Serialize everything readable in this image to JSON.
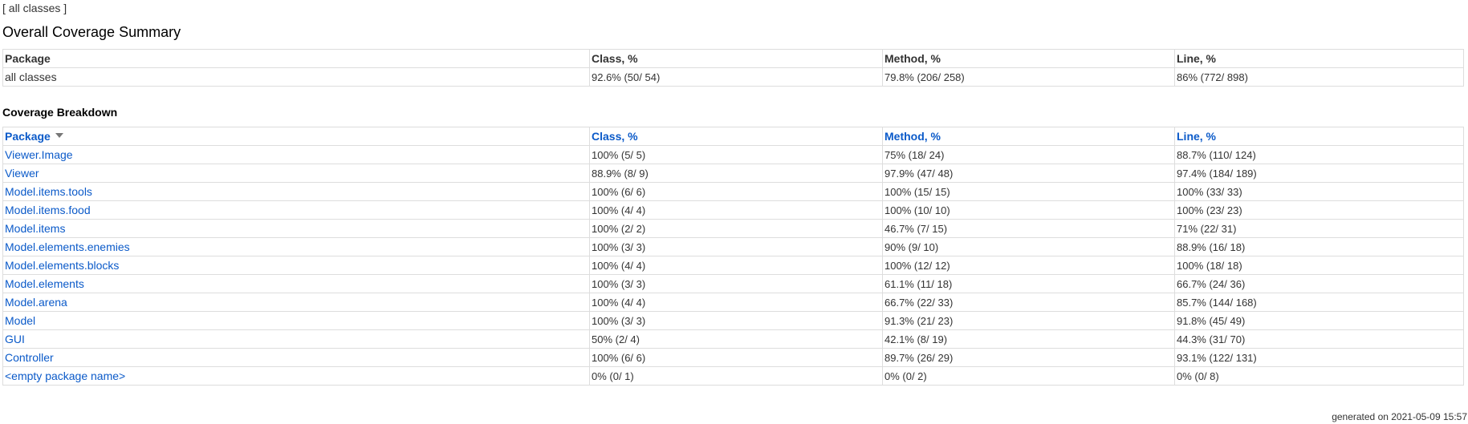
{
  "breadcrumb": "[ all classes ]",
  "page_title": "Overall Coverage Summary",
  "summary": {
    "headers": {
      "package": "Package",
      "class": "Class, %",
      "method": "Method, %",
      "line": "Line, %"
    },
    "row": {
      "name": "all classes",
      "class": "92.6% (50/ 54)",
      "method": "79.8% (206/ 258)",
      "line": "86% (772/ 898)"
    }
  },
  "breakdown": {
    "title": "Coverage Breakdown",
    "headers": {
      "package": "Package",
      "class": "Class, %",
      "method": "Method, %",
      "line": "Line, %"
    },
    "sort_icon": "sort-descending-icon",
    "rows": [
      {
        "name": "Viewer.Image",
        "class": "100% (5/ 5)",
        "method": "75% (18/ 24)",
        "line": "88.7% (110/ 124)"
      },
      {
        "name": "Viewer",
        "class": "88.9% (8/ 9)",
        "method": "97.9% (47/ 48)",
        "line": "97.4% (184/ 189)"
      },
      {
        "name": "Model.items.tools",
        "class": "100% (6/ 6)",
        "method": "100% (15/ 15)",
        "line": "100% (33/ 33)"
      },
      {
        "name": "Model.items.food",
        "class": "100% (4/ 4)",
        "method": "100% (10/ 10)",
        "line": "100% (23/ 23)"
      },
      {
        "name": "Model.items",
        "class": "100% (2/ 2)",
        "method": "46.7% (7/ 15)",
        "line": "71% (22/ 31)"
      },
      {
        "name": "Model.elements.enemies",
        "class": "100% (3/ 3)",
        "method": "90% (9/ 10)",
        "line": "88.9% (16/ 18)"
      },
      {
        "name": "Model.elements.blocks",
        "class": "100% (4/ 4)",
        "method": "100% (12/ 12)",
        "line": "100% (18/ 18)"
      },
      {
        "name": "Model.elements",
        "class": "100% (3/ 3)",
        "method": "61.1% (11/ 18)",
        "line": "66.7% (24/ 36)"
      },
      {
        "name": "Model.arena",
        "class": "100% (4/ 4)",
        "method": "66.7% (22/ 33)",
        "line": "85.7% (144/ 168)"
      },
      {
        "name": "Model",
        "class": "100% (3/ 3)",
        "method": "91.3% (21/ 23)",
        "line": "91.8% (45/ 49)"
      },
      {
        "name": "GUI",
        "class": "50% (2/ 4)",
        "method": "42.1% (8/ 19)",
        "line": "44.3% (31/ 70)"
      },
      {
        "name": "Controller",
        "class": "100% (6/ 6)",
        "method": "89.7% (26/ 29)",
        "line": "93.1% (122/ 131)"
      },
      {
        "name": "<empty package name>",
        "class": "0% (0/ 1)",
        "method": "0% (0/ 2)",
        "line": "0% (0/ 8)"
      }
    ]
  },
  "footer": "generated on 2021-05-09 15:57",
  "colors": {
    "link": "#0b5ac9",
    "border": "#dddddd",
    "text": "#333333"
  }
}
